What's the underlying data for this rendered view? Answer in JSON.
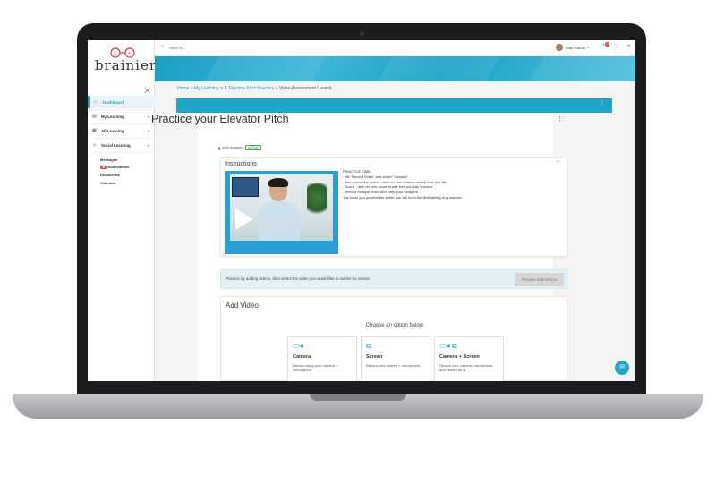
{
  "app": {
    "logo_text": "brainier"
  },
  "header": {
    "search_placeholder": "Search...",
    "user_name": "Kale Francis",
    "notification_count": "13"
  },
  "sidebar": {
    "items": [
      {
        "label": "Dashboard",
        "icon": "home-icon",
        "active": true
      },
      {
        "label": "My Learning",
        "icon": "book-icon",
        "chevron": "▾"
      },
      {
        "label": "All Learning",
        "icon": "grid-icon",
        "chevron": "▾"
      },
      {
        "label": "Social Learning",
        "icon": "people-icon",
        "chevron": "▾"
      }
    ],
    "sub_items": [
      "Messages",
      "Notifications",
      "Documents",
      "Calendar"
    ],
    "notification_badge": "99"
  },
  "breadcrumb": {
    "home": "Home",
    "sep": " > ",
    "my_learning": "My Learning",
    "course": "1. Elevator Pitch Practice",
    "current": "Video Assessment Launch"
  },
  "page": {
    "title": "Practice your Elevator Pitch",
    "analysis_label": "Auto Analysis",
    "status_badge": "ACTIVE"
  },
  "instructions": {
    "title": "Instructions",
    "lines": [
      "PRACTICE TIME!",
      "- Hit \"Record Video\" and select \"Camera\"",
      "- See yourself in action - click on your video to watch how you did",
      "- Score - click on your score to see how you can improve",
      "- Record multiple times and keep your bloopers",
      "The more you practice the better you will be in the field talking to prospects."
    ]
  },
  "practice": {
    "text": "Practice by adding videos, then select the video you would like to submit for review",
    "button": "Prepare Submission"
  },
  "add_video": {
    "title": "Add Video",
    "choose": "Choose an option below",
    "options": [
      {
        "title": "Camera",
        "desc": "Record using your camera + microphone",
        "icon": "camera-icon"
      },
      {
        "title": "Screen",
        "desc": "Record your screen + microphone",
        "icon": "screen-share-icon"
      },
      {
        "title": "Camera + Screen",
        "desc": "Record your camera, microphone, and screen all at",
        "icon": "camera-screen-icon"
      }
    ]
  },
  "colors": {
    "accent": "#1ea5c8",
    "active_green": "#4caf50",
    "badge_red": "#e53935"
  }
}
